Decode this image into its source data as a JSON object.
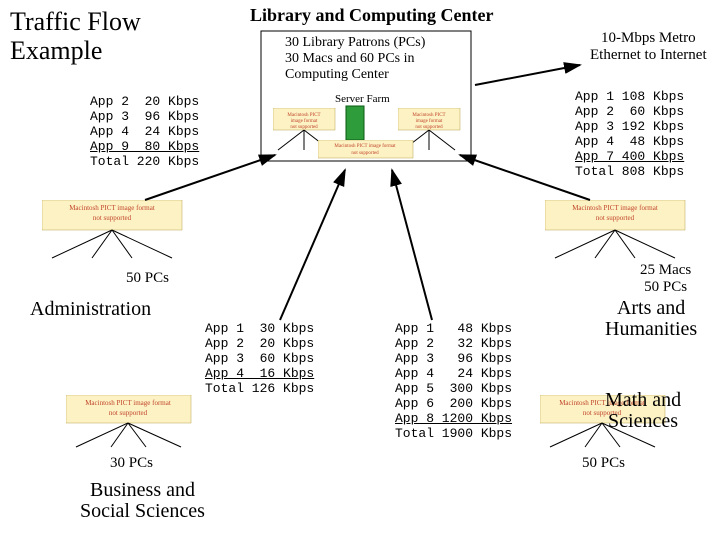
{
  "title_main": "Traffic Flow\nExample",
  "title_library": "Library and Computing Center",
  "title_metro": "10-Mbps Metro\nEthernet to Internet",
  "library_desc": "30 Library Patrons (PCs)\n30 Macs and 60 PCs in\nComputing Center",
  "server_farm": "Server Farm",
  "sections": {
    "admin": "Administration",
    "biz": "Business and\nSocial Sciences",
    "arts": "Arts and\nHumanities",
    "math": "Math and\nSciences"
  },
  "pc_counts": {
    "admin": "50 PCs",
    "biz": "30 PCs",
    "arts": "25 Macs\n50 PCs",
    "math": "50 PCs"
  },
  "tables": {
    "admin": [
      {
        "app": "App 2",
        "val": "20",
        "unit": "Kbps"
      },
      {
        "app": "App 3",
        "val": "96",
        "unit": "Kbps"
      },
      {
        "app": "App 4",
        "val": "24",
        "unit": "Kbps"
      },
      {
        "app": "App 9",
        "val": "80",
        "unit": "Kbps",
        "ul": true
      },
      {
        "app": "Total",
        "val": "220",
        "unit": "Kbps"
      }
    ],
    "metro": [
      {
        "app": "App 1",
        "val": "108",
        "unit": "Kbps"
      },
      {
        "app": "App 2",
        "val": "60",
        "unit": "Kbps"
      },
      {
        "app": "App 3",
        "val": "192",
        "unit": "Kbps"
      },
      {
        "app": "App 4",
        "val": "48",
        "unit": "Kbps"
      },
      {
        "app": "App 7",
        "val": "400",
        "unit": "Kbps",
        "ul": true
      },
      {
        "app": "Total",
        "val": "808",
        "unit": "Kbps"
      }
    ],
    "biz": [
      {
        "app": "App 1",
        "val": "30",
        "unit": "Kbps"
      },
      {
        "app": "App 2",
        "val": "20",
        "unit": "Kbps"
      },
      {
        "app": "App 3",
        "val": "60",
        "unit": "Kbps"
      },
      {
        "app": "App 4",
        "val": "16",
        "unit": "Kbps",
        "ul": true
      },
      {
        "app": "Total",
        "val": "126",
        "unit": "Kbps"
      }
    ],
    "math": [
      {
        "app": "App 1",
        "val": "48",
        "unit": "Kbps"
      },
      {
        "app": "App 2",
        "val": "32",
        "unit": "Kbps"
      },
      {
        "app": "App 3",
        "val": "96",
        "unit": "Kbps"
      },
      {
        "app": "App 4",
        "val": "24",
        "unit": "Kbps"
      },
      {
        "app": "App 5",
        "val": "300",
        "unit": "Kbps"
      },
      {
        "app": "App 6",
        "val": "200",
        "unit": "Kbps"
      },
      {
        "app": "App 8",
        "val": "1200",
        "unit": "Kbps",
        "ul": true
      },
      {
        "app": "Total",
        "val": "1900",
        "unit": "Kbps"
      }
    ]
  }
}
